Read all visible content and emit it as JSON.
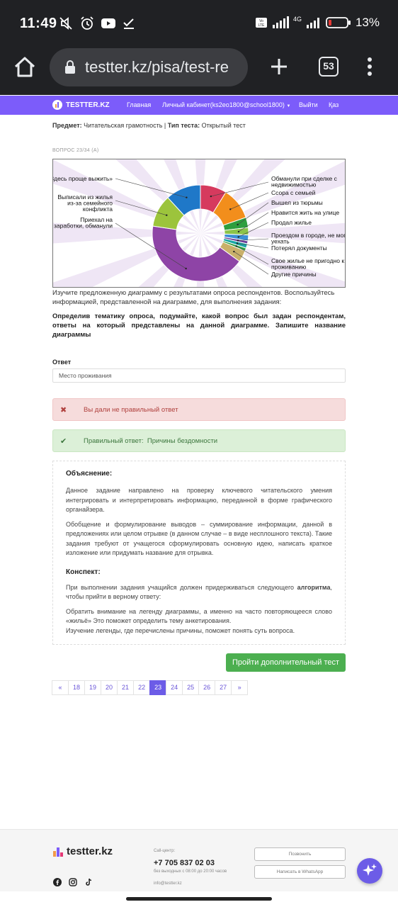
{
  "status_bar": {
    "time": "11:49",
    "network": "4G",
    "battery": "13%"
  },
  "browser": {
    "url": "testter.kz/pisa/test-re",
    "tab_count": "53"
  },
  "site_nav": {
    "brand": "TESTTER.KZ",
    "links": [
      "Главная",
      "Личный кабинет(ks2eo1800@school1800)",
      "Выйти",
      "Қаз"
    ]
  },
  "meta": {
    "subject_label": "Предмет:",
    "subject_value": "Читательская грамотность",
    "type_label": "Тип теста:",
    "type_value": "Открытый тест"
  },
  "question": {
    "number": "ВОПРОС 23/34",
    "intro": "Изучите предложенную диаграмму с результатами опроса респондентов. Воспользуйтесь информацией, представленной на диаграмме, для выполнения задания:",
    "task": "Определив тематику опроса, подумайте, какой вопрос был задан респондентам, ответы на который представлены на данной диаграмме. Запишите название диаграммы"
  },
  "chart_data": {
    "type": "pie",
    "variant": "donut",
    "categories": [
      "Обманули при сделке с недвижимостью",
      "Ссора с семьей",
      "Вышел из тюрьмы",
      "Нравится жить на улице",
      "Продал жилье",
      "Проездом в городе, не могу уехать",
      "Потерял документы",
      "Свое жилье не пригодно к проживанию",
      "Другие причины",
      "Приехал на заработки, обманули",
      "Выписали из жилья из-за семейного конфликта",
      "«Здесь проще выжить»"
    ],
    "values": [
      9,
      11,
      3.5,
      2.5,
      2,
      1,
      1.5,
      1,
      4,
      43,
      11,
      12
    ],
    "colors": [
      "#d63a5e",
      "#f28e1c",
      "#2e9e3e",
      "#8bc34a",
      "#3a8fd6",
      "#6a3d9a",
      "#19a6a6",
      "#2e9e3e",
      "#c9b06a",
      "#8e44a6",
      "#9cc43c",
      "#1f78c8"
    ]
  },
  "answer": {
    "label": "Ответ",
    "value": "Место проживания"
  },
  "feedback": {
    "wrong_text": "Вы дали не правильный ответ",
    "correct_prefix": "Правильный ответ:",
    "correct_value": "Причины бездомности"
  },
  "explanation": {
    "title": "Объяснение:",
    "p1": "Данное задание направлено на проверку ключевого читательского умения интегрировать и интерпретировать информацию, переданной в форме графического органайзера.",
    "p2": "Обобщение и формулирование выводов – суммирование информации, данной в предложениях или целом отрывке (в данном случае – в виде несплошного текста). Такие задания требуют от учащегося сформулировать основную идею, написать краткое изложение или придумать название для отрывка.",
    "conspect_title": "Конспект:",
    "c1_start": "При выполнении задания учащийся должен придерживаться следующего",
    "c1_bold": "алгоритма",
    "c1_end": ", чтобы прийти в верному ответу:",
    "c2": "Обратить внимание на легенду диаграммы, а именно на часто повторяющееся слово «жильё» Это поможет определить тему анкетирования.",
    "c3": "Изучение легенды, где перечислены причины, поможет понять суть вопроса."
  },
  "more_button": "Пройти дополнительный тест",
  "pagination": {
    "items": [
      "«",
      "18",
      "19",
      "20",
      "21",
      "22",
      "23",
      "24",
      "25",
      "26",
      "27",
      "»"
    ],
    "active": "23"
  },
  "footer": {
    "brand": "testter.kz",
    "callcenter_label": "Call-центр:",
    "phone": "+7 705 837 02 03",
    "hours": "без выходных с 08:00 до 20:00 часов",
    "email": "info@testter.kz",
    "call_button": "Позвонить",
    "whatsapp_button": "Написать в WhatsApp"
  }
}
